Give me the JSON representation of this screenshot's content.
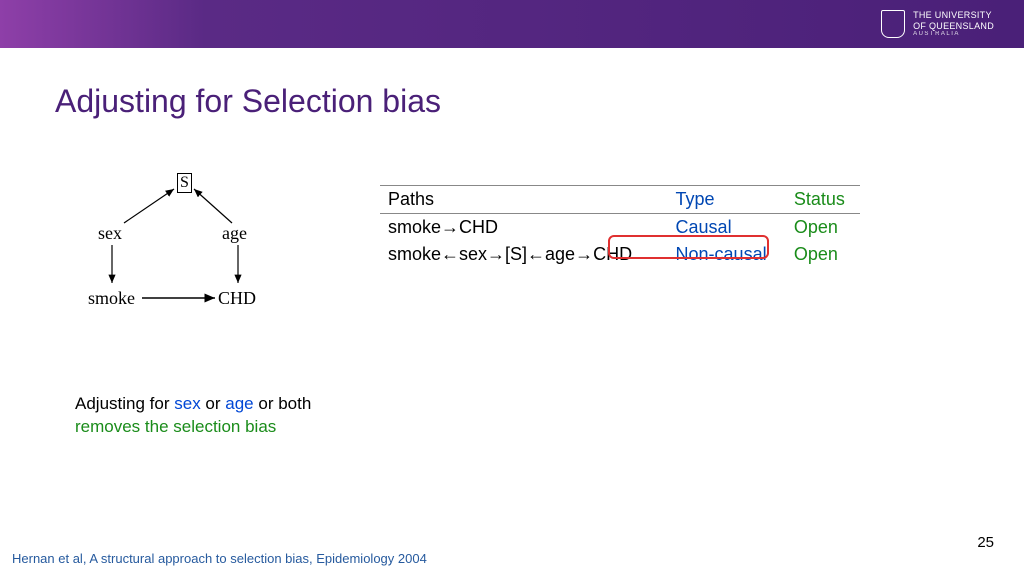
{
  "header": {
    "logo_line1": "THE UNIVERSITY",
    "logo_line2": "OF QUEENSLAND",
    "logo_line3": "AUSTRALIA"
  },
  "title": "Adjusting for Selection bias",
  "dag": {
    "nodes": {
      "s": "S",
      "sex": "sex",
      "age": "age",
      "smoke": "smoke",
      "chd": "CHD"
    }
  },
  "table": {
    "headers": {
      "paths": "Paths",
      "type": "Type",
      "status": "Status"
    },
    "rows": [
      {
        "path": "smoke→CHD",
        "type": "Causal",
        "status": "Open"
      },
      {
        "path": "smoke←sex→[S]←age→CHD",
        "type": "Non-causal",
        "status": "Open"
      }
    ]
  },
  "adjust": {
    "prefix": "Adjusting for ",
    "var1": "sex",
    "mid1": " or ",
    "var2": "age",
    "mid2": " or both",
    "line2": "removes the selection bias"
  },
  "citation": "Hernan et al, A structural approach to selection bias, Epidemiology 2004",
  "page_number": "25"
}
